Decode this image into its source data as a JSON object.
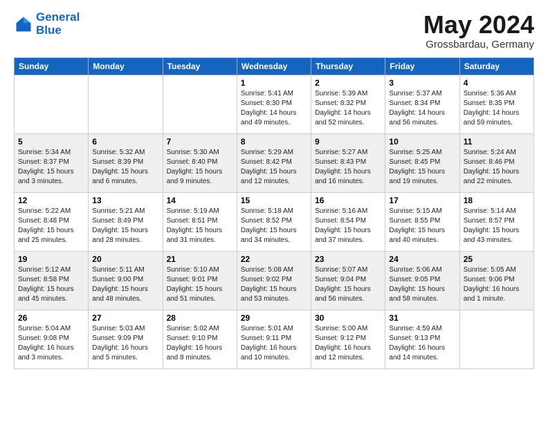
{
  "header": {
    "logo_line1": "General",
    "logo_line2": "Blue",
    "title": "May 2024",
    "subtitle": "Grossbardau, Germany"
  },
  "weekdays": [
    "Sunday",
    "Monday",
    "Tuesday",
    "Wednesday",
    "Thursday",
    "Friday",
    "Saturday"
  ],
  "weeks": [
    [
      {
        "day": "",
        "info": ""
      },
      {
        "day": "",
        "info": ""
      },
      {
        "day": "",
        "info": ""
      },
      {
        "day": "1",
        "info": "Sunrise: 5:41 AM\nSunset: 8:30 PM\nDaylight: 14 hours\nand 49 minutes."
      },
      {
        "day": "2",
        "info": "Sunrise: 5:39 AM\nSunset: 8:32 PM\nDaylight: 14 hours\nand 52 minutes."
      },
      {
        "day": "3",
        "info": "Sunrise: 5:37 AM\nSunset: 8:34 PM\nDaylight: 14 hours\nand 56 minutes."
      },
      {
        "day": "4",
        "info": "Sunrise: 5:36 AM\nSunset: 8:35 PM\nDaylight: 14 hours\nand 59 minutes."
      }
    ],
    [
      {
        "day": "5",
        "info": "Sunrise: 5:34 AM\nSunset: 8:37 PM\nDaylight: 15 hours\nand 3 minutes."
      },
      {
        "day": "6",
        "info": "Sunrise: 5:32 AM\nSunset: 8:39 PM\nDaylight: 15 hours\nand 6 minutes."
      },
      {
        "day": "7",
        "info": "Sunrise: 5:30 AM\nSunset: 8:40 PM\nDaylight: 15 hours\nand 9 minutes."
      },
      {
        "day": "8",
        "info": "Sunrise: 5:29 AM\nSunset: 8:42 PM\nDaylight: 15 hours\nand 12 minutes."
      },
      {
        "day": "9",
        "info": "Sunrise: 5:27 AM\nSunset: 8:43 PM\nDaylight: 15 hours\nand 16 minutes."
      },
      {
        "day": "10",
        "info": "Sunrise: 5:25 AM\nSunset: 8:45 PM\nDaylight: 15 hours\nand 19 minutes."
      },
      {
        "day": "11",
        "info": "Sunrise: 5:24 AM\nSunset: 8:46 PM\nDaylight: 15 hours\nand 22 minutes."
      }
    ],
    [
      {
        "day": "12",
        "info": "Sunrise: 5:22 AM\nSunset: 8:48 PM\nDaylight: 15 hours\nand 25 minutes."
      },
      {
        "day": "13",
        "info": "Sunrise: 5:21 AM\nSunset: 8:49 PM\nDaylight: 15 hours\nand 28 minutes."
      },
      {
        "day": "14",
        "info": "Sunrise: 5:19 AM\nSunset: 8:51 PM\nDaylight: 15 hours\nand 31 minutes."
      },
      {
        "day": "15",
        "info": "Sunrise: 5:18 AM\nSunset: 8:52 PM\nDaylight: 15 hours\nand 34 minutes."
      },
      {
        "day": "16",
        "info": "Sunrise: 5:16 AM\nSunset: 8:54 PM\nDaylight: 15 hours\nand 37 minutes."
      },
      {
        "day": "17",
        "info": "Sunrise: 5:15 AM\nSunset: 8:55 PM\nDaylight: 15 hours\nand 40 minutes."
      },
      {
        "day": "18",
        "info": "Sunrise: 5:14 AM\nSunset: 8:57 PM\nDaylight: 15 hours\nand 43 minutes."
      }
    ],
    [
      {
        "day": "19",
        "info": "Sunrise: 5:12 AM\nSunset: 8:58 PM\nDaylight: 15 hours\nand 45 minutes."
      },
      {
        "day": "20",
        "info": "Sunrise: 5:11 AM\nSunset: 9:00 PM\nDaylight: 15 hours\nand 48 minutes."
      },
      {
        "day": "21",
        "info": "Sunrise: 5:10 AM\nSunset: 9:01 PM\nDaylight: 15 hours\nand 51 minutes."
      },
      {
        "day": "22",
        "info": "Sunrise: 5:08 AM\nSunset: 9:02 PM\nDaylight: 15 hours\nand 53 minutes."
      },
      {
        "day": "23",
        "info": "Sunrise: 5:07 AM\nSunset: 9:04 PM\nDaylight: 15 hours\nand 56 minutes."
      },
      {
        "day": "24",
        "info": "Sunrise: 5:06 AM\nSunset: 9:05 PM\nDaylight: 15 hours\nand 58 minutes."
      },
      {
        "day": "25",
        "info": "Sunrise: 5:05 AM\nSunset: 9:06 PM\nDaylight: 16 hours\nand 1 minute."
      }
    ],
    [
      {
        "day": "26",
        "info": "Sunrise: 5:04 AM\nSunset: 9:08 PM\nDaylight: 16 hours\nand 3 minutes."
      },
      {
        "day": "27",
        "info": "Sunrise: 5:03 AM\nSunset: 9:09 PM\nDaylight: 16 hours\nand 5 minutes."
      },
      {
        "day": "28",
        "info": "Sunrise: 5:02 AM\nSunset: 9:10 PM\nDaylight: 16 hours\nand 8 minutes."
      },
      {
        "day": "29",
        "info": "Sunrise: 5:01 AM\nSunset: 9:11 PM\nDaylight: 16 hours\nand 10 minutes."
      },
      {
        "day": "30",
        "info": "Sunrise: 5:00 AM\nSunset: 9:12 PM\nDaylight: 16 hours\nand 12 minutes."
      },
      {
        "day": "31",
        "info": "Sunrise: 4:59 AM\nSunset: 9:13 PM\nDaylight: 16 hours\nand 14 minutes."
      },
      {
        "day": "",
        "info": ""
      }
    ]
  ]
}
